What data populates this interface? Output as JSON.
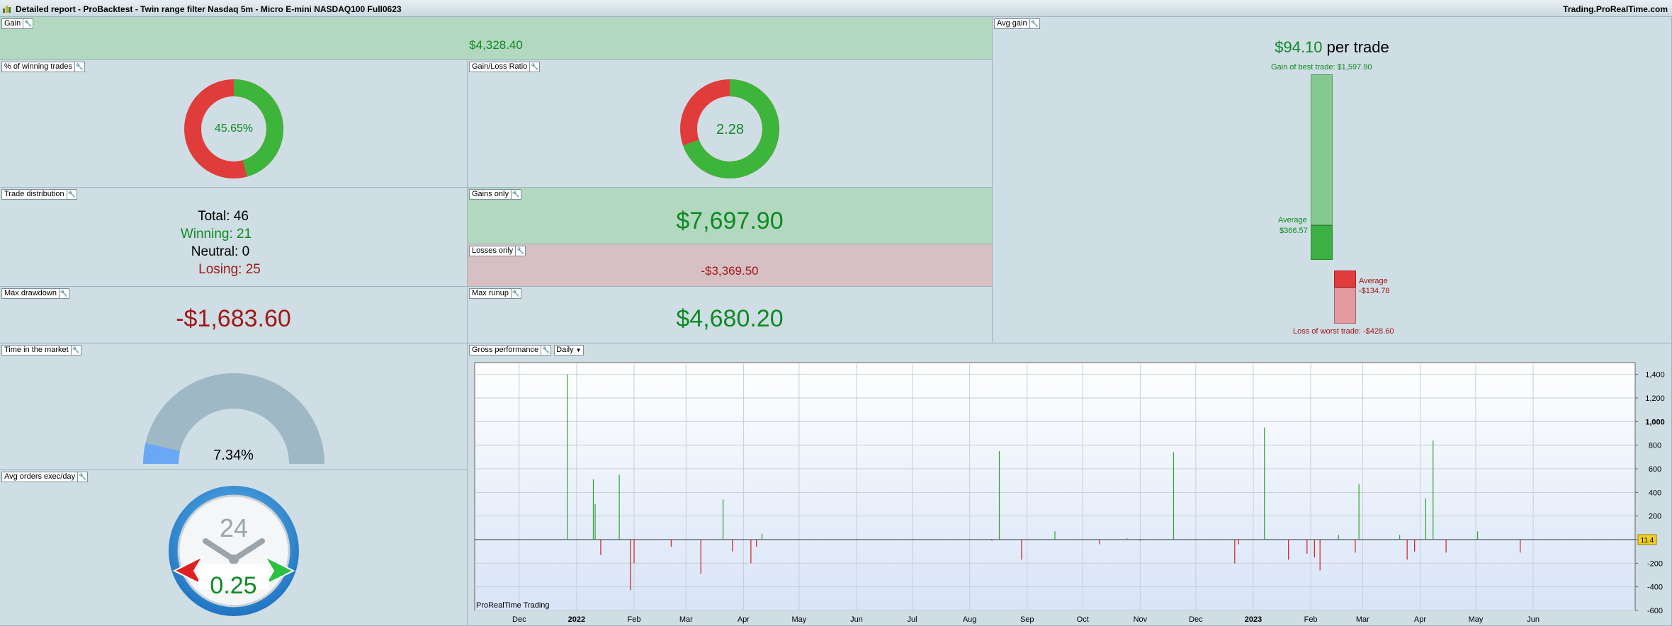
{
  "window": {
    "title": "Detailed report - ProBacktest - Twin range filter Nasdaq 5m - Micro E-mini NASDAQ100 Full0623",
    "brand": "Trading.ProRealTime.com"
  },
  "gain": {
    "label": "Gain",
    "value": "$4,328.40"
  },
  "avg_gain": {
    "label": "Avg gain",
    "value": "$94.10",
    "suffix": "per trade",
    "best_label": "Gain of best trade: $1,597.90",
    "avg_win_label": "Average",
    "avg_win_value": "$366.57",
    "avg_loss_label": "Average",
    "avg_loss_value": "-$134.78",
    "worst_label": "Loss of worst trade: -$428.60",
    "best": 1597.9,
    "avg_win": 366.57,
    "avg_loss": -134.78,
    "worst": -428.6
  },
  "winning_pct": {
    "label": "% of winning trades",
    "value": "45.65%",
    "fraction": 0.4565,
    "colors": {
      "win": "#3db53a",
      "loss": "#e03c3c"
    }
  },
  "gain_loss_ratio": {
    "label": "Gain/Loss Ratio",
    "value": "2.28",
    "fraction": 0.695
  },
  "trade_distribution": {
    "label": "Trade distribution",
    "rows": [
      {
        "name": "Total:",
        "value": "46"
      },
      {
        "name": "Winning:",
        "value": "21"
      },
      {
        "name": "Neutral:",
        "value": "0"
      },
      {
        "name": "Losing:",
        "value": "25"
      }
    ]
  },
  "gains_only": {
    "label": "Gains only",
    "value": "$7,697.90"
  },
  "losses_only": {
    "label": "Losses only",
    "value": "-$3,369.50"
  },
  "max_drawdown": {
    "label": "Max drawdown",
    "value": "-$1,683.60"
  },
  "max_runup": {
    "label": "Max runup",
    "value": "$4,680.20"
  },
  "time_in_market": {
    "label": "Time in the market",
    "value": "7.34%",
    "fraction": 0.0734
  },
  "avg_orders": {
    "label": "Avg orders exec/day",
    "value": "0.25",
    "clock_label": "24"
  },
  "gross_performance": {
    "label": "Gross performance",
    "period": "Daily",
    "watermark": "ProRealTime Trading",
    "current_value_badge": "11.4"
  },
  "chart_data": {
    "type": "bar",
    "title": "",
    "ylim": [
      -600,
      1500
    ],
    "yticks": [
      "1,400",
      "1,200",
      "1,000",
      "800",
      "600",
      "400",
      "200",
      "0",
      "-200",
      "-400",
      "-600"
    ],
    "ytick_values": [
      1400,
      1200,
      1000,
      800,
      600,
      400,
      200,
      0,
      -200,
      -400,
      -600
    ],
    "xmonths": [
      {
        "label": "Dec",
        "bold": false,
        "day": 0
      },
      {
        "label": "2022",
        "bold": true,
        "day": 31
      },
      {
        "label": "Feb",
        "bold": false,
        "day": 62
      },
      {
        "label": "Mar",
        "bold": false,
        "day": 90
      },
      {
        "label": "Apr",
        "bold": false,
        "day": 121
      },
      {
        "label": "May",
        "bold": false,
        "day": 151
      },
      {
        "label": "Jun",
        "bold": false,
        "day": 182
      },
      {
        "label": "Jul",
        "bold": false,
        "day": 212
      },
      {
        "label": "Aug",
        "bold": false,
        "day": 243
      },
      {
        "label": "Sep",
        "bold": false,
        "day": 274
      },
      {
        "label": "Oct",
        "bold": false,
        "day": 304
      },
      {
        "label": "Nov",
        "bold": false,
        "day": 335
      },
      {
        "label": "Dec",
        "bold": false,
        "day": 365
      },
      {
        "label": "2023",
        "bold": true,
        "day": 396
      },
      {
        "label": "Feb",
        "bold": false,
        "day": 427
      },
      {
        "label": "Mar",
        "bold": false,
        "day": 455
      },
      {
        "label": "Apr",
        "bold": false,
        "day": 486
      },
      {
        "label": "May",
        "bold": false,
        "day": 516
      },
      {
        "label": "Jun",
        "bold": false,
        "day": 547
      }
    ],
    "xrange_days": [
      -24,
      602
    ],
    "bars": [
      {
        "day": 26,
        "value": 1400
      },
      {
        "day": 40,
        "value": 510
      },
      {
        "day": 41,
        "value": 300
      },
      {
        "day": 44,
        "value": -130
      },
      {
        "day": 54,
        "value": 550
      },
      {
        "day": 60,
        "value": -430
      },
      {
        "day": 62,
        "value": -200
      },
      {
        "day": 82,
        "value": -60
      },
      {
        "day": 98,
        "value": -290
      },
      {
        "day": 110,
        "value": 340
      },
      {
        "day": 115,
        "value": -100
      },
      {
        "day": 125,
        "value": -200
      },
      {
        "day": 128,
        "value": -60
      },
      {
        "day": 131,
        "value": 50
      },
      {
        "day": 255,
        "value": -10
      },
      {
        "day": 259,
        "value": 750
      },
      {
        "day": 271,
        "value": -170
      },
      {
        "day": 289,
        "value": 70
      },
      {
        "day": 313,
        "value": -40
      },
      {
        "day": 328,
        "value": 10
      },
      {
        "day": 335,
        "value": -10
      },
      {
        "day": 353,
        "value": 740
      },
      {
        "day": 386,
        "value": -200
      },
      {
        "day": 388,
        "value": -40
      },
      {
        "day": 402,
        "value": 950
      },
      {
        "day": 415,
        "value": -170
      },
      {
        "day": 425,
        "value": -120
      },
      {
        "day": 429,
        "value": -150
      },
      {
        "day": 432,
        "value": -260
      },
      {
        "day": 442,
        "value": 40
      },
      {
        "day": 451,
        "value": -110
      },
      {
        "day": 453,
        "value": 470
      },
      {
        "day": 475,
        "value": 40
      },
      {
        "day": 479,
        "value": -170
      },
      {
        "day": 483,
        "value": -100
      },
      {
        "day": 489,
        "value": 350
      },
      {
        "day": 493,
        "value": 840
      },
      {
        "day": 500,
        "value": -110
      },
      {
        "day": 517,
        "value": 70
      },
      {
        "day": 540,
        "value": -110
      }
    ],
    "colors": {
      "positive": "#2aa52a",
      "negative": "#cc2020"
    }
  }
}
